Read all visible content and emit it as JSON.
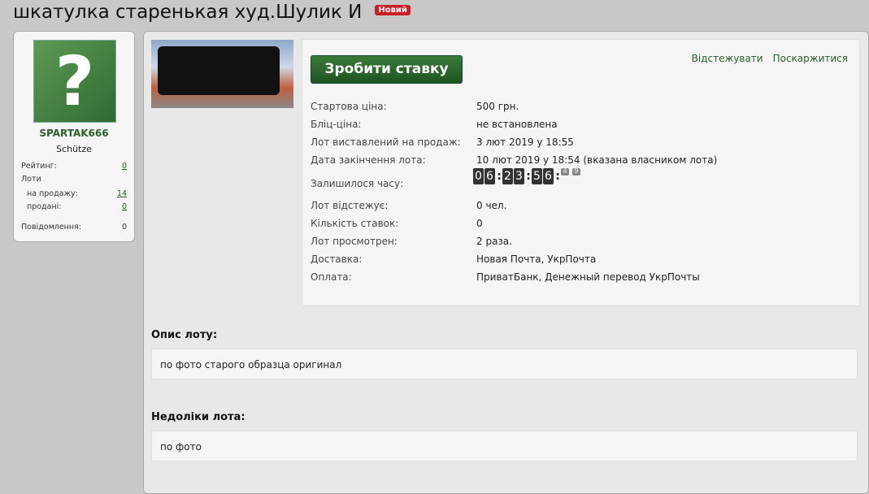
{
  "title": "шкатулка старенькая худ.Шулик И",
  "badge": "Новий",
  "user": {
    "name": "SPARTAK666",
    "rank": "Schütze",
    "avatar_icon": "question-mark-icon",
    "stats": [
      {
        "label": "Рейтинг:",
        "value": "0"
      },
      {
        "label": "Лоти",
        "value": ""
      },
      {
        "label": "на продажу:",
        "value": "14"
      },
      {
        "label": "продані:",
        "value": "0"
      },
      {
        "label": "Повідомлення:",
        "value": "0"
      }
    ]
  },
  "bid_button": "Зробити ставку",
  "links": {
    "watch": "Відстежувати",
    "report": "Поскаржитися"
  },
  "details": [
    {
      "label": "Стартова ціна:",
      "value": "500 грн."
    },
    {
      "label": "Бліц-ціна:",
      "value": "не встановлена"
    },
    {
      "label": "Лот виставлений на продаж:",
      "value": "3 лют 2019 у 18:55"
    },
    {
      "label": "Дата закінчення лота:",
      "value": "10 лют 2019 у 18:54 (вказана власником лота)"
    },
    {
      "label": "Залишилося часу:",
      "value": ""
    },
    {
      "label": "Лот відстежує:",
      "value": "0 чел."
    },
    {
      "label": "Кількість ставок:",
      "value": "0"
    },
    {
      "label": "Лот просмотрен:",
      "value": "2 раза."
    },
    {
      "label": "Доставка:",
      "value": "Новая Почта, УкрПочта"
    },
    {
      "label": "Оплата:",
      "value": "ПриватБанк, Денежный перевод УкрПочты"
    }
  ],
  "timer": {
    "h": [
      "0",
      "6"
    ],
    "m": [
      "2",
      "3"
    ],
    "s": [
      "5",
      "6"
    ],
    "sec": [
      "4",
      "9"
    ]
  },
  "description": {
    "heading": "Опис лоту:",
    "text": "по фото старого образца оригинал"
  },
  "defects": {
    "heading": "Недоліки лота:",
    "text": "по фото"
  }
}
